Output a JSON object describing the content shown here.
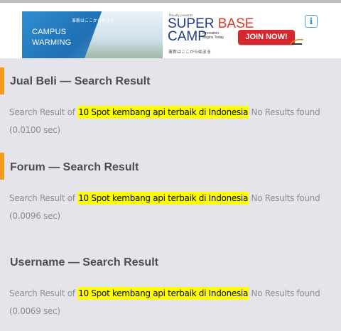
{
  "ad": {
    "left_jp": "革新はここから始まる",
    "left_title_1": "CAMPUS",
    "left_title_2": "WARMING",
    "powered": "Proudly presents",
    "super": "SUPER",
    "base": "BASE",
    "camp": "CAMP",
    "tagline": "Innovation Begins Today",
    "right_jp": "革新はここから始まる",
    "join_label": "JOIN NOW!",
    "info_icon": "i"
  },
  "sections": [
    {
      "title": "Jual Beli — Search Result",
      "prefix": "Search Result of",
      "query": "10 Spot kembang api terbaik di Indonesia",
      "suffix": "No Results found (0.0100 sec)"
    },
    {
      "title": "Forum — Search Result",
      "prefix": "Search Result of",
      "query": "10 Spot kembang api terbaik di Indonesia",
      "suffix": "No Results found (0.0096 sec)"
    },
    {
      "title": "Username — Search Result",
      "prefix": "Search Result of",
      "query": "10 Spot kembang api terbaik di Indonesia",
      "suffix": "No Results found (0.0069 sec)"
    }
  ],
  "colors": {
    "accent": "#f29a1c",
    "highlight": "#ffff00",
    "background": "#e5e4ea"
  }
}
